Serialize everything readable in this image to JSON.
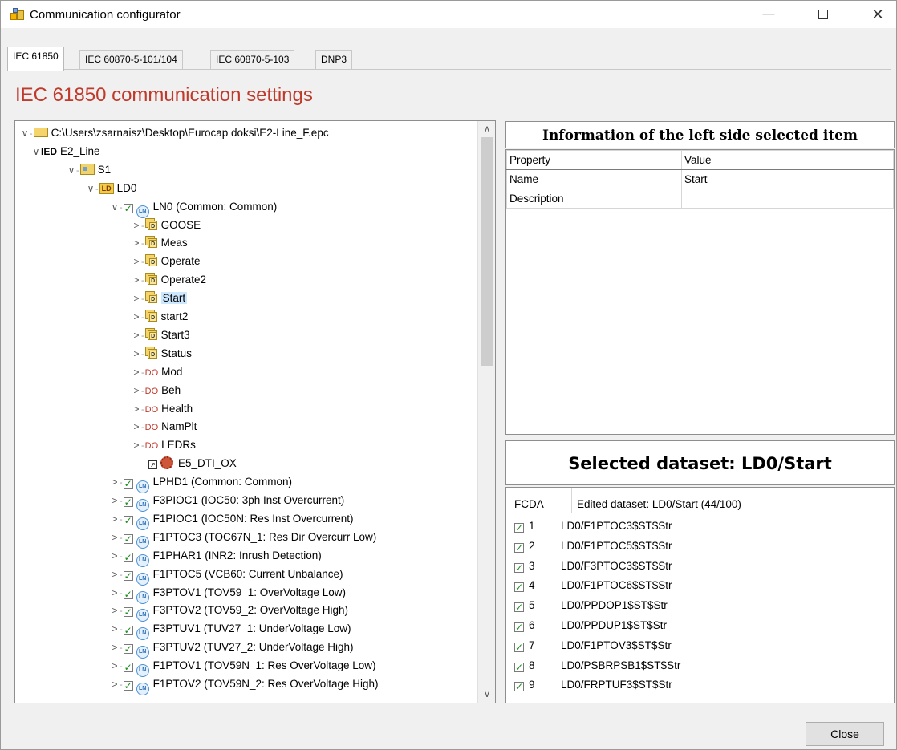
{
  "window": {
    "title": "Communication configurator",
    "minimize": "—",
    "close": "✕"
  },
  "tabs": [
    "IEC 61850",
    "IEC 60870-5-101/104",
    "IEC 60870-5-103",
    "DNP3"
  ],
  "heading": "IEC 61850 communication settings",
  "tree": {
    "root": "C:\\Users\\zsarnaisz\\Desktop\\Eurocap doksi\\E2-Line_F.epc",
    "ied_tag": "IED",
    "ied": "E2_Line",
    "server": "S1",
    "ld_tag": "LD",
    "ld": "LD0",
    "ln_tag": "LN",
    "ds_tag": "D",
    "do_tag": "DO",
    "ln0": "LN0 (Common: Common)",
    "datasets": [
      "GOOSE",
      "Meas",
      "Operate",
      "Operate2",
      "Start",
      "start2",
      "Start3",
      "Status"
    ],
    "dos": [
      "Mod",
      "Beh",
      "Health",
      "NamPlt",
      "LEDRs"
    ],
    "link_item": "E5_DTI_OX",
    "lns": [
      "LPHD1 (Common: Common)",
      "F3PIOC1 (IOC50: 3ph Inst Overcurrent)",
      "F1PIOC1 (IOC50N: Res Inst Overcurrent)",
      "F1PTOC3 (TOC67N_1: Res Dir Overcurr Low)",
      "F1PHAR1 (INR2: Inrush Detection)",
      "F1PTOC5 (VCB60: Current Unbalance)",
      "F3PTOV1 (TOV59_1: OverVoltage Low)",
      "F3PTOV2 (TOV59_2: OverVoltage High)",
      "F3PTUV1 (TUV27_1: UnderVoltage Low)",
      "F3PTUV2 (TUV27_2: UnderVoltage High)",
      "F1PTOV1 (TOV59N_1: Res OverVoltage Low)",
      "F1PTOV2 (TOV59N_2: Res OverVoltage High)"
    ]
  },
  "info": {
    "header": "Information of the left side selected item",
    "col_property": "Property",
    "col_value": "Value",
    "rows": [
      {
        "property": "Name",
        "value": "Start"
      },
      {
        "property": "Description",
        "value": ""
      }
    ]
  },
  "dataset": {
    "header": "Selected dataset: LD0/Start",
    "col_fcda": "FCDA",
    "edited": "Edited dataset: LD0/Start  (44/100)",
    "rows": [
      {
        "num": "1",
        "path": "LD0/F1PTOC3$ST$Str"
      },
      {
        "num": "2",
        "path": "LD0/F1PTOC5$ST$Str"
      },
      {
        "num": "3",
        "path": "LD0/F3PTOC3$ST$Str"
      },
      {
        "num": "4",
        "path": "LD0/F1PTOC6$ST$Str"
      },
      {
        "num": "5",
        "path": "LD0/PPDOP1$ST$Str"
      },
      {
        "num": "6",
        "path": "LD0/PPDUP1$ST$Str"
      },
      {
        "num": "7",
        "path": "LD0/F1PTOV3$ST$Str"
      },
      {
        "num": "8",
        "path": "LD0/PSBRPSB1$ST$Str"
      },
      {
        "num": "9",
        "path": "LD0/FRPTUF3$ST$Str"
      }
    ]
  },
  "buttons": {
    "close": "Close"
  },
  "glyphs": {
    "expanded": "∨",
    "collapsed": ">",
    "check": "✓",
    "scroll_up": "∧",
    "scroll_down": "∨",
    "link": "↗"
  }
}
